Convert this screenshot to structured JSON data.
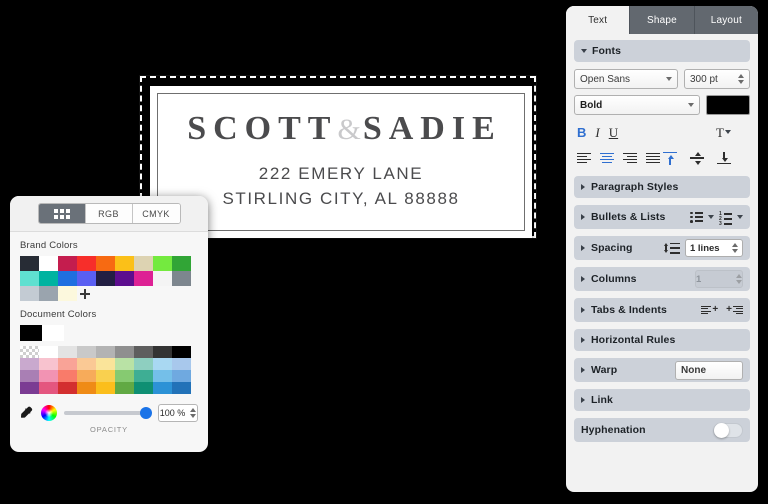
{
  "card": {
    "title_left": "SCOTT",
    "title_amp": "&",
    "title_right": "SADIE",
    "address_line1": "222 EMERY LANE",
    "address_line2": "STIRLING CITY, AL 88888"
  },
  "color_panel": {
    "tabs": [
      {
        "label": "",
        "icon": "grid-icon",
        "active": true
      },
      {
        "label": "RGB",
        "active": false
      },
      {
        "label": "CMYK",
        "active": false
      }
    ],
    "brand_colors_label": "Brand Colors",
    "brand_colors": [
      [
        "#272c35",
        "#ffffff",
        "#c41d4e",
        "#f72e2a",
        "#f76a12",
        "#fbc018",
        "#ddd3b2",
        "#74ea3f",
        "#31a536"
      ],
      [
        "#5fe0d0",
        "#00b3a0",
        "#1f6fe0",
        "#5a5ff2",
        "#221f43",
        "#5c0d8e",
        "#dd2194",
        "#f4f4f4",
        "#7d868e"
      ],
      [
        "#c3cbd3",
        "#9aa4ae",
        "#fcf8dd",
        "",
        "",
        "",
        "",
        "",
        ""
      ]
    ],
    "add_swatch_label": "+",
    "document_colors_label": "Document Colors",
    "document_current": [
      "#000000",
      "#ffffff"
    ],
    "palette": [
      [
        "transparent",
        "#ffffff",
        "#e3e3e3",
        "#c9c9c9",
        "#b3b3b3",
        "#8f8f8f",
        "#5e5e5e",
        "#333333",
        "#000000"
      ],
      [
        "#c9a9ce",
        "#f8c3cf",
        "#f9a397",
        "#fac995",
        "#fae49a",
        "#b9e2a5",
        "#8ecfc0",
        "#a9d8f2",
        "#a8c8ec"
      ],
      [
        "#a97fb4",
        "#f293b3",
        "#f97b6a",
        "#f7ab5a",
        "#f9d04f",
        "#86ca71",
        "#3eae94",
        "#74bfe9",
        "#6fa9e0"
      ],
      [
        "#7b3c93",
        "#e4567f",
        "#d32f2f",
        "#ef8b16",
        "#fbbe1b",
        "#61a944",
        "#0f8f73",
        "#2c92d6",
        "#2272b8"
      ]
    ],
    "eyedropper_icon": "eyedropper-icon",
    "wheel_icon": "color-wheel-icon",
    "opacity_value": "100 %",
    "opacity_caption": "OPACITY"
  },
  "text_panel": {
    "tabs": [
      {
        "label": "Text",
        "active": true
      },
      {
        "label": "Shape",
        "active": false
      },
      {
        "label": "Layout",
        "active": false
      }
    ],
    "fonts": {
      "section_label": "Fonts",
      "family": "Open Sans",
      "size": "300 pt",
      "style": "Bold",
      "color": "#000000",
      "bold_label": "B",
      "italic_label": "I",
      "underline_label": "U",
      "text_options_label": "T"
    },
    "paragraph_styles_label": "Paragraph Styles",
    "bullets_lists_label": "Bullets & Lists",
    "spacing": {
      "label": "Spacing",
      "value": "1 lines"
    },
    "columns": {
      "label": "Columns",
      "value": "1"
    },
    "tabs_indents_label": "Tabs & Indents",
    "horizontal_rules_label": "Horizontal Rules",
    "warp": {
      "label": "Warp",
      "value": "None"
    },
    "link_label": "Link",
    "hyphenation": {
      "label": "Hyphenation",
      "enabled": false
    }
  }
}
